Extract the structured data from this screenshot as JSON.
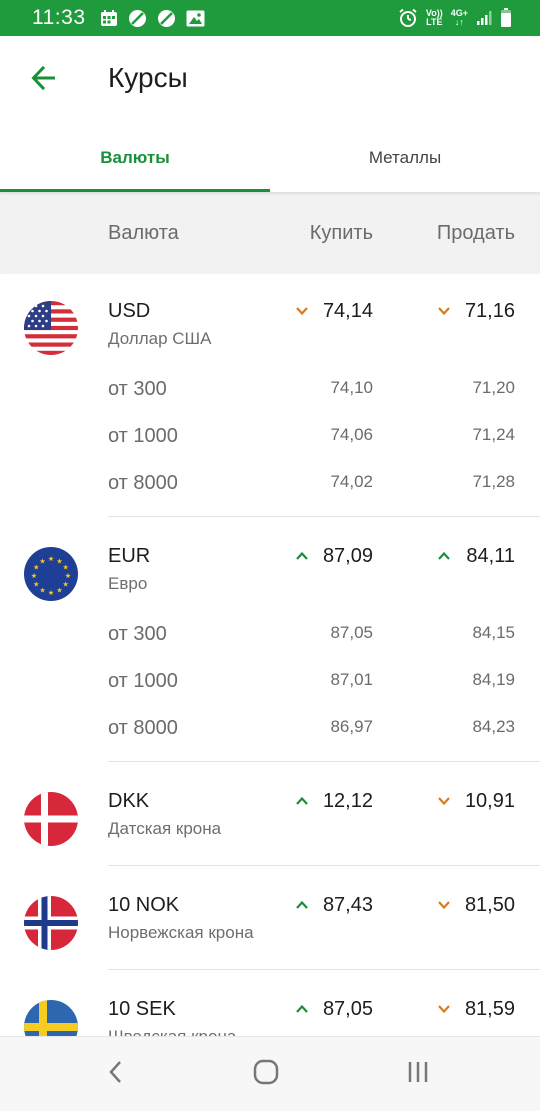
{
  "status_bar": {
    "time": "11:33",
    "volte_top": "Vo))",
    "volte_bottom": "LTE",
    "network": "4G+",
    "icons": [
      "calendar-icon",
      "no-entry-icon",
      "no-entry-icon",
      "image-icon",
      "alarm-icon",
      "signal-icon",
      "battery-icon"
    ]
  },
  "app_bar": {
    "title": "Курсы",
    "back_icon": "arrow-left-icon"
  },
  "tabs": [
    {
      "label": "Валюты",
      "active": true
    },
    {
      "label": "Металлы",
      "active": false
    }
  ],
  "columns": {
    "currency": "Валюта",
    "buy": "Купить",
    "sell": "Продать"
  },
  "currencies": [
    {
      "code": "USD",
      "name": "Доллар США",
      "flag": "flag-us-icon",
      "buy": "74,14",
      "buy_trend": "down",
      "sell": "71,16",
      "sell_trend": "down",
      "tiers": [
        {
          "label": "от 300",
          "buy": "74,10",
          "sell": "71,20"
        },
        {
          "label": "от 1000",
          "buy": "74,06",
          "sell": "71,24"
        },
        {
          "label": "от 8000",
          "buy": "74,02",
          "sell": "71,28"
        }
      ]
    },
    {
      "code": "EUR",
      "name": "Евро",
      "flag": "flag-eu-icon",
      "buy": "87,09",
      "buy_trend": "up",
      "sell": "84,11",
      "sell_trend": "up",
      "tiers": [
        {
          "label": "от 300",
          "buy": "87,05",
          "sell": "84,15"
        },
        {
          "label": "от 1000",
          "buy": "87,01",
          "sell": "84,19"
        },
        {
          "label": "от 8000",
          "buy": "86,97",
          "sell": "84,23"
        }
      ]
    },
    {
      "code": "DKK",
      "name": "Датская крона",
      "flag": "flag-dk-icon",
      "buy": "12,12",
      "buy_trend": "up",
      "sell": "10,91",
      "sell_trend": "down"
    },
    {
      "code": "10 NOK",
      "name": "Норвежская крона",
      "flag": "flag-no-icon",
      "buy": "87,43",
      "buy_trend": "up",
      "sell": "81,50",
      "sell_trend": "down"
    },
    {
      "code": "10 SEK",
      "name": "Шведская крона",
      "flag": "flag-se-icon",
      "buy": "87,05",
      "buy_trend": "up",
      "sell": "81,59",
      "sell_trend": "down"
    }
  ],
  "colors": {
    "accent": "#1a8f3a",
    "status_bar": "#1f9a3c",
    "up": "#1a8f3a",
    "down": "#d97a1e"
  },
  "nav_bar": {
    "icons": [
      "back-icon",
      "home-icon",
      "recents-icon"
    ]
  }
}
